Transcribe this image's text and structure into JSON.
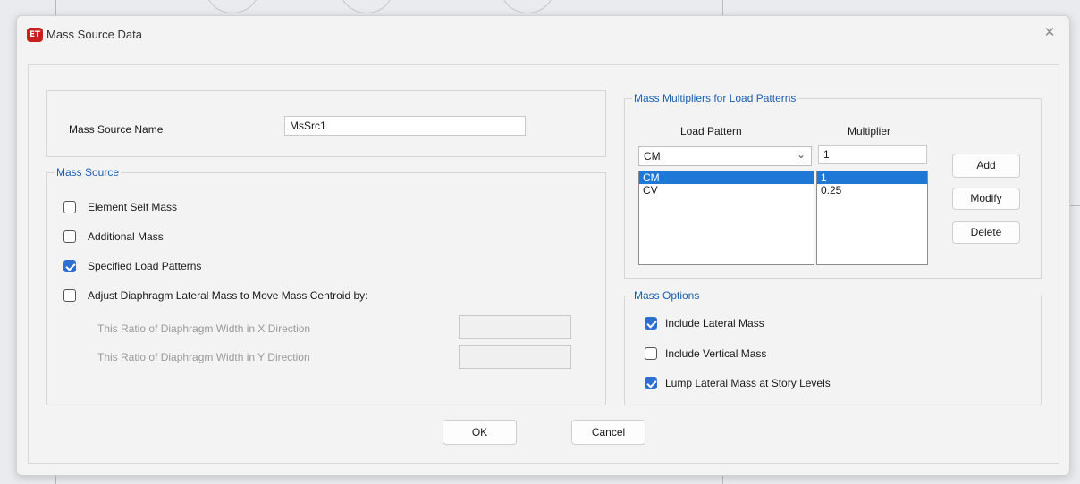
{
  "dialog": {
    "title": "Mass Source Data",
    "app_icon_text": "ET",
    "close_glyph": "✕"
  },
  "name_section": {
    "label": "Mass Source Name",
    "value": "MsSrc1"
  },
  "mass_source": {
    "legend": "Mass Source",
    "options": [
      {
        "label": "Element Self Mass",
        "checked": false
      },
      {
        "label": "Additional Mass",
        "checked": false
      },
      {
        "label": "Specified Load Patterns",
        "checked": true
      },
      {
        "label": "Adjust Diaphragm Lateral Mass to Move Mass Centroid by:",
        "checked": false
      }
    ],
    "ratio_x_label": "This Ratio of Diaphragm Width in X Direction",
    "ratio_x_value": "",
    "ratio_y_label": "This Ratio of Diaphragm Width in Y Direction",
    "ratio_y_value": ""
  },
  "multipliers": {
    "legend": "Mass Multipliers for Load Patterns",
    "col_pattern": "Load Pattern",
    "col_multiplier": "Multiplier",
    "selected_pattern": "CM",
    "multiplier_value": "1",
    "rows": [
      {
        "pattern": "CM",
        "multiplier": "1",
        "selected": true
      },
      {
        "pattern": "CV",
        "multiplier": "0.25",
        "selected": false
      }
    ],
    "add_label": "Add",
    "modify_label": "Modify",
    "delete_label": "Delete"
  },
  "mass_options": {
    "legend": "Mass Options",
    "options": [
      {
        "label": "Include Lateral Mass",
        "checked": true
      },
      {
        "label": "Include Vertical Mass",
        "checked": false
      },
      {
        "label": "Lump Lateral Mass at Story Levels",
        "checked": true
      }
    ]
  },
  "footer": {
    "ok_label": "OK",
    "cancel_label": "Cancel"
  },
  "colors": {
    "accent": "#2c6fd1",
    "legend_text": "#1a5fb4",
    "selection": "#1f78d6",
    "icon_red": "#c81f1f"
  }
}
